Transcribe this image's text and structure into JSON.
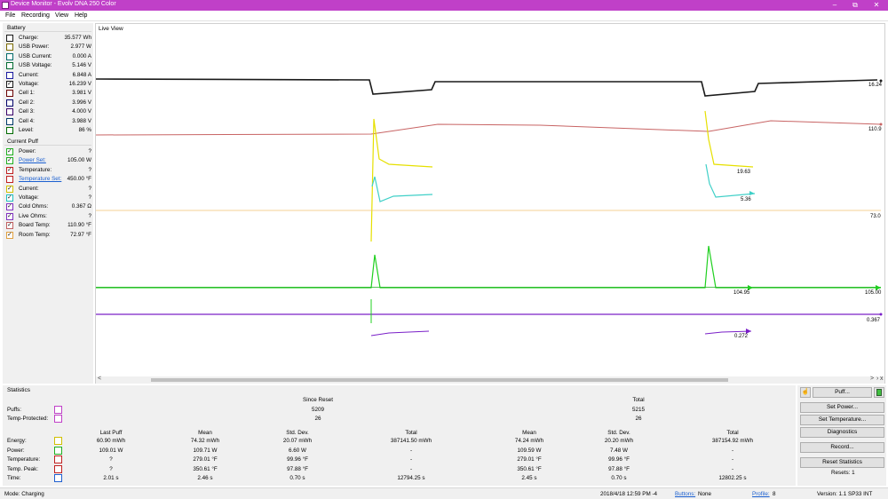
{
  "window": {
    "title": "Device Monitor - Evolv DNA 250 Color",
    "minimize": "–",
    "maximize": "⧉",
    "close": "✕"
  },
  "menu": [
    "File",
    "Recording",
    "View",
    "Help"
  ],
  "battery": {
    "title": "Battery",
    "rows": [
      {
        "label": "Charge:",
        "value": "35.577 Wh",
        "color": "#1a1a1a",
        "checked": false
      },
      {
        "label": "USB Power:",
        "value": "2.977 W",
        "color": "#7a6a00",
        "checked": false
      },
      {
        "label": "USB Current:",
        "value": "0.000 A",
        "color": "#006a6a",
        "checked": false
      },
      {
        "label": "USB Voltage:",
        "value": "5.146 V",
        "color": "#006a30",
        "checked": false
      },
      {
        "label": "Current:",
        "value": "6.848 A",
        "color": "#1a1aa0",
        "checked": false
      },
      {
        "label": "Voltage:",
        "value": "16.239 V",
        "color": "#1a1a1a",
        "checked": true
      },
      {
        "label": "Cell 1:",
        "value": "3.981 V",
        "color": "#6a0000",
        "checked": false
      },
      {
        "label": "Cell 2:",
        "value": "3.996 V",
        "color": "#00006a",
        "checked": false
      },
      {
        "label": "Cell 3:",
        "value": "4.000 V",
        "color": "#3a006a",
        "checked": false
      },
      {
        "label": "Cell 4:",
        "value": "3.988 V",
        "color": "#003a6a",
        "checked": false
      },
      {
        "label": "Level:",
        "value": "86 %",
        "color": "#006a00",
        "checked": false
      }
    ]
  },
  "puff": {
    "title": "Current Puff",
    "rows": [
      {
        "label": "Power:",
        "value": "?",
        "color": "#20b020",
        "checked": true,
        "link": false
      },
      {
        "label": "Power Set:",
        "value": "105.00 W",
        "color": "#20b020",
        "checked": true,
        "link": true
      },
      {
        "label": "Temperature:",
        "value": "?",
        "color": "#c02020",
        "checked": true,
        "link": false
      },
      {
        "label": "Temperature Set:",
        "value": "450.00 °F",
        "color": "#c02020",
        "checked": false,
        "link": true
      },
      {
        "label": "Current:",
        "value": "?",
        "color": "#d0c000",
        "checked": true,
        "link": false
      },
      {
        "label": "Voltage:",
        "value": "?",
        "color": "#20c0c0",
        "checked": true,
        "link": false
      },
      {
        "label": "Cold Ohms:",
        "value": "0.367 Ω",
        "color": "#8030c0",
        "checked": true,
        "link": false
      },
      {
        "label": "Live Ohms:",
        "value": "?",
        "color": "#8030c0",
        "checked": true,
        "link": false
      },
      {
        "label": "Board Temp:",
        "value": "110.90 °F",
        "color": "#c06060",
        "checked": true,
        "link": false
      },
      {
        "label": "Room Temp:",
        "value": "72.97 °F",
        "color": "#e0a040",
        "checked": true,
        "link": false
      }
    ]
  },
  "liveview": {
    "title": "Live View",
    "end_labels": [
      "16.24",
      "110.9",
      "19.63",
      "5.36",
      "73.0",
      "104.95",
      "105.00",
      "0.367",
      "0.272"
    ],
    "colors": {
      "voltage": "#1a1a1a",
      "board": "#c86464",
      "current": "#e6e000",
      "volt2": "#40d0c8",
      "room": "#f0c070",
      "power": "#20d020",
      "ohms": "#7a20c8",
      "live": "#7a20c8"
    },
    "scroll": {
      "left": "<",
      "right": ">",
      "end": "›",
      "x": "x"
    }
  },
  "statistics": {
    "title": "Statistics",
    "since_reset": "Since Reset",
    "total": "Total",
    "puffs_label": "Puffs:",
    "puffs_since": "5209",
    "puffs_total": "5215",
    "tp_label": "Temp-Protected:",
    "tp_since": "26",
    "tp_total": "26",
    "headers": [
      "Last Puff",
      "Mean",
      "Std. Dev.",
      "Total",
      "Mean",
      "Std. Dev.",
      "Total"
    ],
    "rows": [
      {
        "label": "Energy:",
        "color": "#d0c000",
        "cells": [
          "60.90 mWh",
          "74.32 mWh",
          "20.07 mWh",
          "387141.50 mWh",
          "74.24 mWh",
          "20.20 mWh",
          "387154.92 mWh"
        ]
      },
      {
        "label": "Power:",
        "color": "#20b020",
        "cells": [
          "109.01 W",
          "109.71 W",
          "6.60 W",
          "-",
          "109.59 W",
          "7.48 W",
          "-"
        ]
      },
      {
        "label": "Temperature:",
        "color": "#c02020",
        "cells": [
          "?",
          "279.01 °F",
          "99.96 °F",
          "-",
          "279.01 °F",
          "99.96 °F",
          "-"
        ]
      },
      {
        "label": "Temp. Peak:",
        "color": "#c02020",
        "cells": [
          "?",
          "350.61 °F",
          "97.88 °F",
          "-",
          "350.61 °F",
          "97.88 °F",
          "-"
        ]
      },
      {
        "label": "Time:",
        "color": "#2060d0",
        "cells": [
          "2.01 s",
          "2.46 s",
          "0.70 s",
          "12794.25 s",
          "2.45 s",
          "0.70 s",
          "12802.25 s"
        ]
      }
    ],
    "puff_box_color": "#c040c8"
  },
  "actions": {
    "puff": "Puff...",
    "set_power": "Set Power...",
    "set_temperature": "Set Temperature...",
    "diagnostics": "Diagnostics",
    "record": "Record...",
    "reset_statistics": "Reset Statistics",
    "resets": "Resets: 1"
  },
  "status": {
    "mode": "Mode: Charging",
    "datetime": "2018/4/18 12:59 PM -4",
    "buttons_label": "Buttons:",
    "buttons_value": "None",
    "profile_label": "Profile:",
    "profile_value": "8",
    "version": "Version: 1.1 SP33 INT"
  }
}
